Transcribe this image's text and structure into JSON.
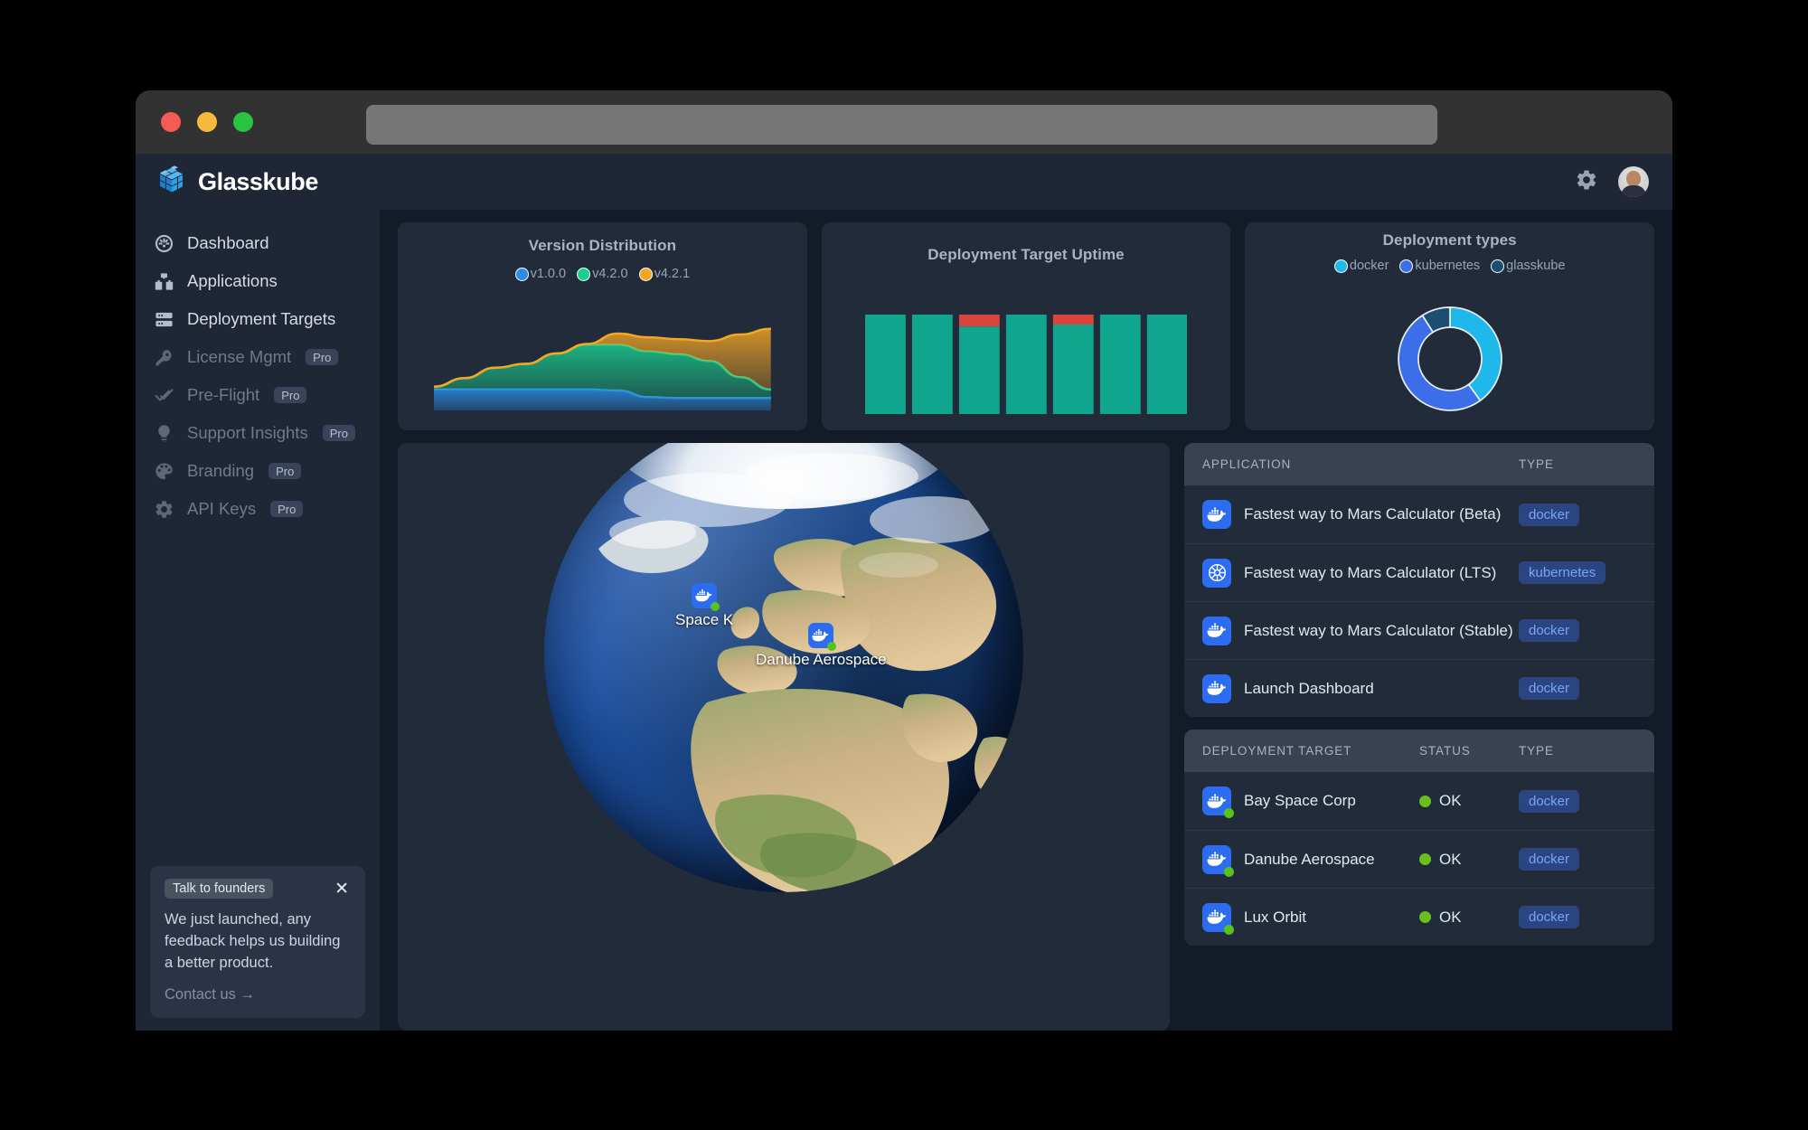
{
  "browser": {
    "traffic_lights": [
      "close",
      "minimize",
      "maximize"
    ],
    "url_value": "",
    "url_placeholder": ""
  },
  "header": {
    "brand": "Glasskube",
    "logo_icon": "glasskube-cube-icon",
    "settings_icon": "gear-icon",
    "avatar_icon": "user-avatar"
  },
  "sidebar": {
    "items": [
      {
        "label": "Dashboard",
        "icon": "gauge-icon",
        "pro": "",
        "active": true
      },
      {
        "label": "Applications",
        "icon": "boxes-icon",
        "pro": "",
        "active": false
      },
      {
        "label": "Deployment Targets",
        "icon": "server-icon",
        "pro": "",
        "active": false
      },
      {
        "label": "License Mgmt",
        "icon": "key-icon",
        "pro": "Pro",
        "active": false
      },
      {
        "label": "Pre-Flight",
        "icon": "checks-icon",
        "pro": "Pro",
        "active": false
      },
      {
        "label": "Support Insights",
        "icon": "bulb-icon",
        "pro": "Pro",
        "active": false
      },
      {
        "label": "Branding",
        "icon": "palette-icon",
        "pro": "Pro",
        "active": false
      },
      {
        "label": "API Keys",
        "icon": "gear-icon",
        "pro": "Pro",
        "active": false
      }
    ],
    "promo": {
      "tag": "Talk to founders",
      "close_icon": "close-icon",
      "text": "We just launched, any feedback helps us building a better product.",
      "link": "Contact us →"
    }
  },
  "chart_data": [
    {
      "type": "area",
      "title": "Version Distribution",
      "xlabel": "",
      "ylabel": "",
      "grid": false,
      "legend_position": "top",
      "stacked": true,
      "x": [
        0,
        1,
        2,
        3,
        4,
        5,
        6,
        7,
        8,
        9,
        10,
        11
      ],
      "series": [
        {
          "name": "v1.0.0",
          "color": "#2b8ce8",
          "values": [
            22,
            22,
            22,
            22,
            22,
            22,
            21,
            14,
            13,
            13,
            13,
            13
          ]
        },
        {
          "name": "v4.2.0",
          "color": "#19cf8e",
          "values": [
            3,
            12,
            23,
            27,
            38,
            47,
            48,
            48,
            46,
            39,
            22,
            9
          ]
        },
        {
          "name": "v4.2.1",
          "color": "#f5a623",
          "values": [
            0,
            0,
            0,
            0,
            0,
            1,
            12,
            15,
            16,
            21,
            45,
            64
          ]
        }
      ],
      "ylim": [
        0,
        100
      ]
    },
    {
      "type": "bar",
      "title": "Deployment Target Uptime",
      "xlabel": "",
      "ylabel": "",
      "grid": false,
      "categories": [
        "1",
        "2",
        "3",
        "4",
        "5",
        "6",
        "7"
      ],
      "series": [
        {
          "name": "uptime",
          "color": "#0fa58e",
          "values": [
            100,
            100,
            88,
            100,
            90,
            100,
            100
          ]
        },
        {
          "name": "downtime",
          "color": "#d9453c",
          "values": [
            0,
            0,
            12,
            0,
            10,
            0,
            0
          ]
        }
      ],
      "ylim": [
        0,
        100
      ]
    },
    {
      "type": "pie",
      "title": "Deployment types",
      "donut": true,
      "legend_position": "top",
      "labels": [
        "docker",
        "kubernetes",
        "glasskube"
      ],
      "values": [
        40,
        51,
        9
      ],
      "colors": [
        "#1eb8eb",
        "#3b6ee8",
        "#1b4e72"
      ]
    }
  ],
  "globe": {
    "markers": [
      {
        "label": "Space K",
        "icon": "docker-icon",
        "status": "ok"
      },
      {
        "label": "Danube Aerospace",
        "icon": "docker-icon",
        "status": "ok"
      }
    ]
  },
  "applications_table": {
    "columns": [
      "APPLICATION",
      "TYPE"
    ],
    "rows": [
      {
        "name": "Fastest way to Mars Calculator (Beta)",
        "icon": "docker-icon",
        "type": "docker"
      },
      {
        "name": "Fastest way to Mars Calculator (LTS)",
        "icon": "kubernetes-icon",
        "type": "kubernetes"
      },
      {
        "name": "Fastest way to Mars Calculator (Stable)",
        "icon": "docker-icon",
        "type": "docker"
      },
      {
        "name": "Launch Dashboard",
        "icon": "docker-icon",
        "type": "docker"
      }
    ]
  },
  "targets_table": {
    "columns": [
      "DEPLOYMENT TARGET",
      "STATUS",
      "TYPE"
    ],
    "rows": [
      {
        "name": "Bay Space Corp",
        "icon": "docker-icon",
        "status": "OK",
        "type": "docker"
      },
      {
        "name": "Danube Aerospace",
        "icon": "docker-icon",
        "status": "OK",
        "type": "docker"
      },
      {
        "name": "Lux Orbit",
        "icon": "docker-icon",
        "status": "OK",
        "type": "docker"
      }
    ]
  },
  "colors": {
    "page_background": "#141b28",
    "sidebar": "#1f2736",
    "card": "#222b3a",
    "table_header": "#384253",
    "accent_blue": "#2b6cf0",
    "status_green": "#69bf1b",
    "chip_text": "#79a5f5"
  }
}
